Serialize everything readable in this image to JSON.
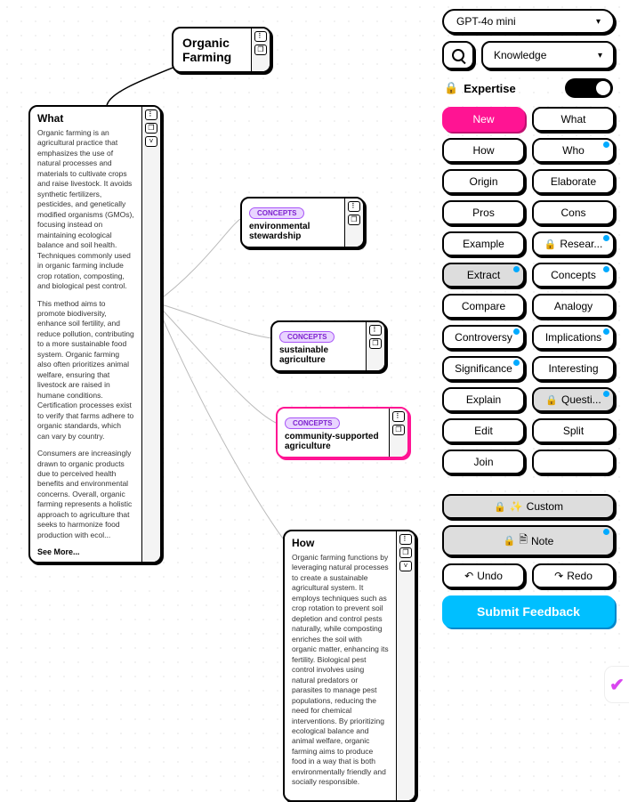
{
  "model": "GPT-4o mini",
  "mode": "Knowledge",
  "expertise_label": "Expertise",
  "root": {
    "title": "Organic Farming"
  },
  "cards": {
    "what": {
      "title": "What",
      "p1": "Organic farming is an agricultural practice that emphasizes the use of natural processes and materials to cultivate crops and raise livestock. It avoids synthetic fertilizers, pesticides, and genetically modified organisms (GMOs), focusing instead on maintaining ecological balance and soil health. Techniques commonly used in organic farming include crop rotation, composting, and biological pest control.",
      "p2": "This method aims to promote biodiversity, enhance soil fertility, and reduce pollution, contributing to a more sustainable food system. Organic farming also often prioritizes animal welfare, ensuring that livestock are raised in humane conditions. Certification processes exist to verify that farms adhere to organic standards, which can vary by country.",
      "p3": "Consumers are increasingly drawn to organic products due to perceived health benefits and environmental concerns. Overall, organic farming represents a holistic approach to agriculture that seeks to harmonize food production with ecol...",
      "see_more": "See More..."
    },
    "how": {
      "title": "How",
      "p1": "Organic farming functions by leveraging natural processes to create a sustainable agricultural system. It employs techniques such as crop rotation to prevent soil depletion and control pests naturally, while composting enriches the soil with organic matter, enhancing its fertility. Biological pest control involves using natural predators or parasites to manage pest populations, reducing the need for chemical interventions. By prioritizing ecological balance and animal welfare, organic farming aims to produce food in a way that is both environmentally friendly and socially responsible."
    }
  },
  "concepts": [
    {
      "badge": "CONCEPTS",
      "label": "environmental stewardship"
    },
    {
      "badge": "CONCEPTS",
      "label": "sustainable agriculture"
    },
    {
      "badge": "CONCEPTS",
      "label": "community-supported agriculture"
    }
  ],
  "sidebar": {
    "buttons": [
      {
        "label": "New",
        "selected": true
      },
      {
        "label": "What"
      },
      {
        "label": "How"
      },
      {
        "label": "Who",
        "dot": true
      },
      {
        "label": "Origin"
      },
      {
        "label": "Elaborate"
      },
      {
        "label": "Pros"
      },
      {
        "label": "Cons"
      },
      {
        "label": "Example"
      },
      {
        "label": "Resear...",
        "lock": true,
        "dot": true
      },
      {
        "label": "Extract",
        "disabled": true,
        "dot": true
      },
      {
        "label": "Concepts",
        "dot": true
      },
      {
        "label": "Compare"
      },
      {
        "label": "Analogy"
      },
      {
        "label": "Controversy",
        "dot": true
      },
      {
        "label": "Implications",
        "dot": true
      },
      {
        "label": "Significance",
        "dot": true
      },
      {
        "label": "Interesting"
      },
      {
        "label": "Explain"
      },
      {
        "label": "Questi...",
        "lock": true,
        "disabled": true,
        "dot": true
      },
      {
        "label": "Edit"
      },
      {
        "label": "Split"
      },
      {
        "label": "Join"
      },
      {
        "label": ""
      }
    ],
    "custom": "Custom",
    "note": "Note",
    "undo": "Undo",
    "redo": "Redo",
    "submit": "Submit Feedback"
  }
}
